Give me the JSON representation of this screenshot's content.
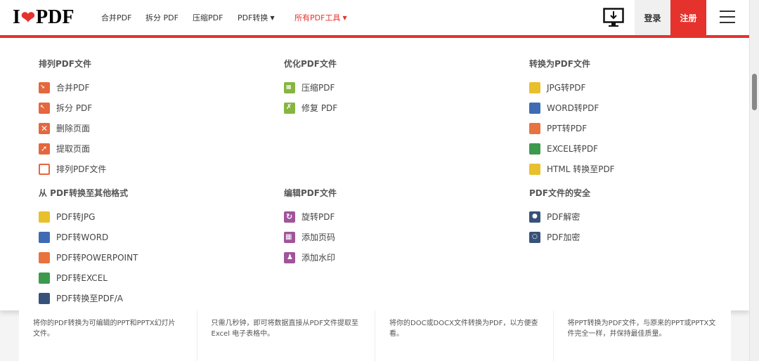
{
  "logo": {
    "pre": "I",
    "post": "PDF"
  },
  "nav": {
    "merge": "合并PDF",
    "split": "拆分 PDF",
    "compress": "压缩PDF",
    "convert": "PDF转换",
    "all_tools": "所有PDF工具"
  },
  "auth": {
    "login": "登录",
    "register": "注册"
  },
  "menu": {
    "organize": {
      "title": "排列PDF文件",
      "items": [
        "合并PDF",
        "拆分 PDF",
        "删除页面",
        "提取页面",
        "排列PDF文件"
      ]
    },
    "optimize": {
      "title": "优化PDF文件",
      "items": [
        "压缩PDF",
        "修复 PDF"
      ]
    },
    "to_pdf": {
      "title": "转换为PDF文件",
      "items": [
        "JPG转PDF",
        "WORD转PDF",
        "PPT转PDF",
        "EXCEL转PDF",
        "HTML 转换至PDF"
      ]
    },
    "from_pdf": {
      "title": "从 PDF转换至其他格式",
      "items": [
        "PDF转JPG",
        "PDF转WORD",
        "PDF转POWERPOINT",
        "PDF转EXCEL",
        "PDF转换至PDF/A"
      ]
    },
    "edit": {
      "title": "编辑PDF文件",
      "items": [
        "旋转PDF",
        "添加页码",
        "添加水印"
      ]
    },
    "security": {
      "title": "PDF文件的安全",
      "items": [
        "PDF解密",
        "PDF加密"
      ]
    }
  },
  "cards": [
    "将你的PDF转换为可编辑的PPT和PPTX幻灯片文件。",
    "只需几秒钟，即可将数据直接从PDF文件提取至Excel 电子表格中。",
    "将你的DOC或DOCX文件转换为PDF，以方便查看。",
    "将PPT转换为PDF文件，与原来的PPT或PPTX文件完全一样，并保持最佳质量。"
  ],
  "colors": {
    "brand": "#e5322d",
    "organize": "#e5673d",
    "optimize": "#86b541",
    "jpg": "#e8c02c",
    "word": "#3e6bb3",
    "ppt": "#e8733e",
    "excel": "#3d9a4d",
    "html": "#e8c02c",
    "edit": "#a0559a",
    "security": "#37527a"
  }
}
